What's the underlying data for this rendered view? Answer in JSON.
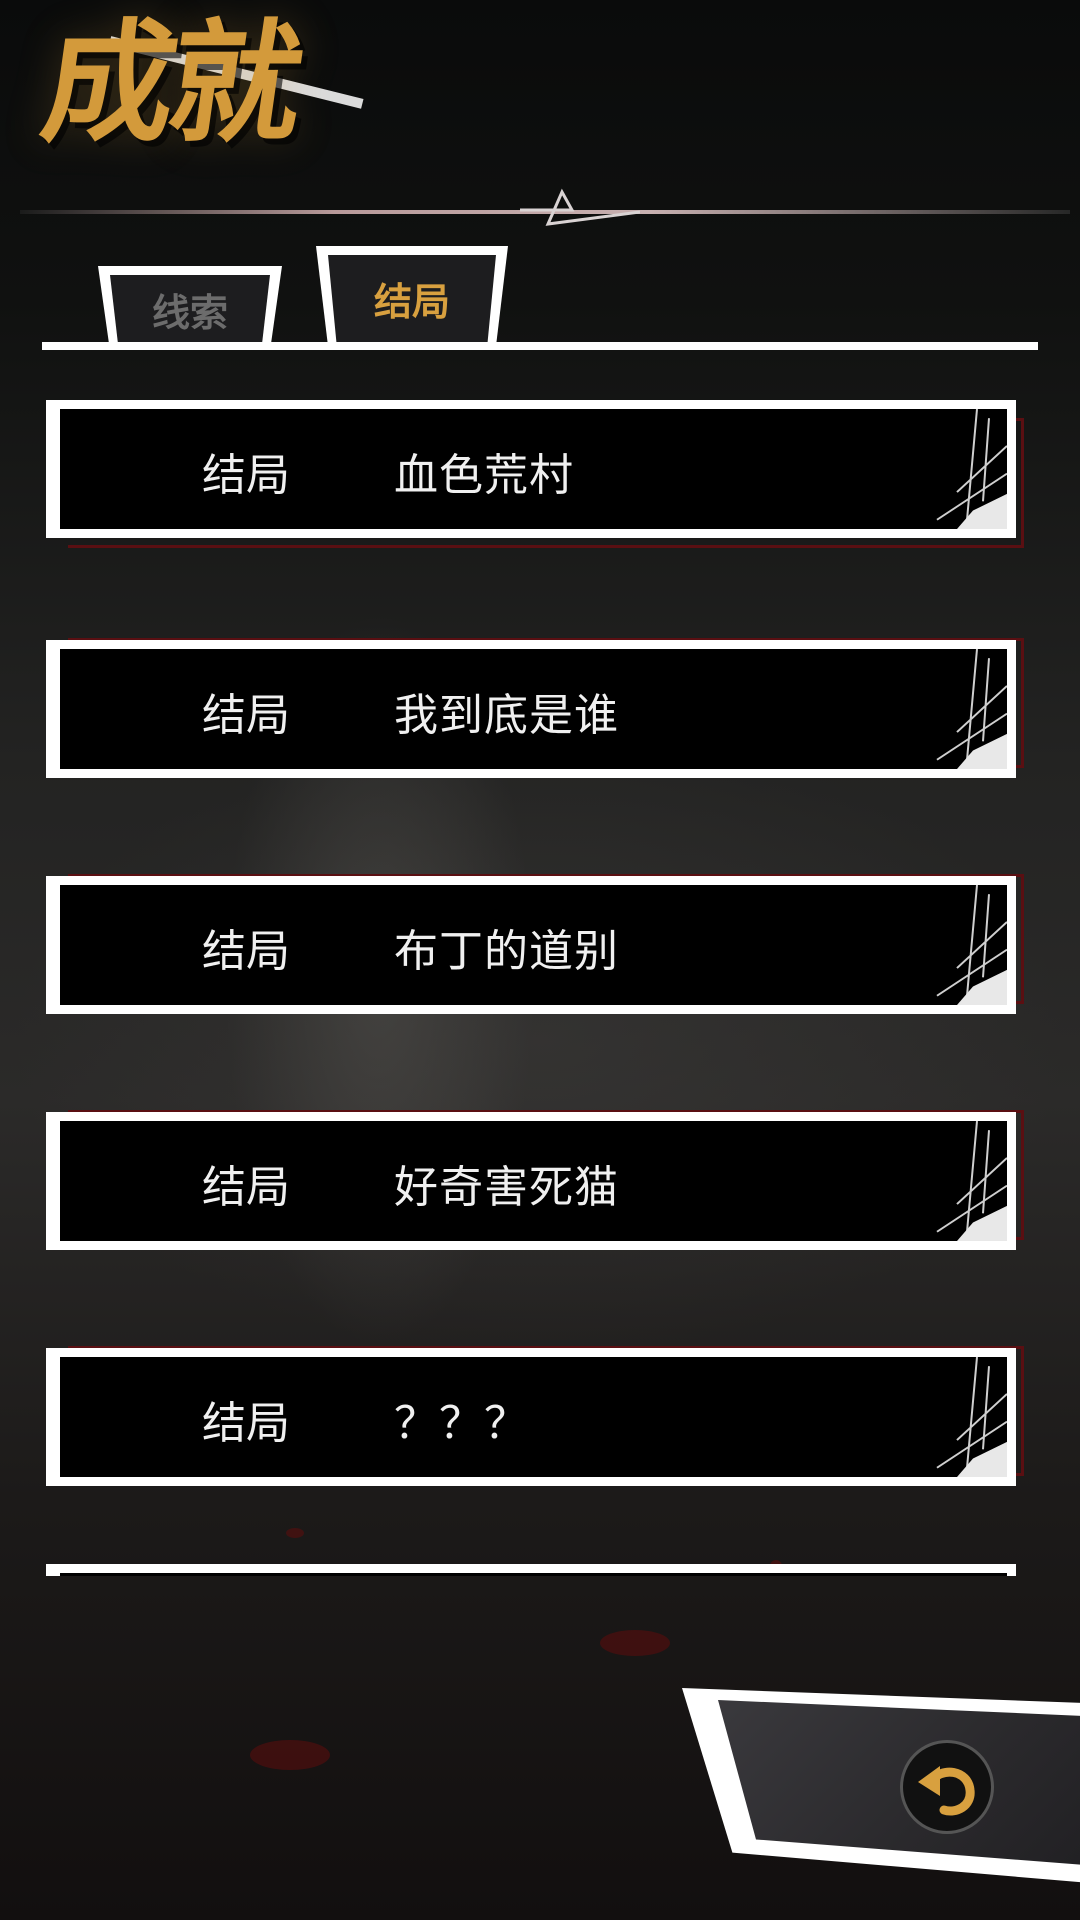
{
  "header": {
    "title": "成就"
  },
  "tabs": [
    {
      "label": "线索",
      "active": false
    },
    {
      "label": "结局",
      "active": true
    }
  ],
  "colors": {
    "accent": "#d8a03f",
    "inactive_tab": "#6c6c6c",
    "row_shadow": "#5a0f12"
  },
  "endings": [
    {
      "tag": "结局",
      "name": "血色荒村"
    },
    {
      "tag": "结局",
      "name": "我到底是谁"
    },
    {
      "tag": "结局",
      "name": "布丁的道别"
    },
    {
      "tag": "结局",
      "name": "好奇害死猫"
    },
    {
      "tag": "结局",
      "name": "？？？"
    },
    {
      "tag": "",
      "name": ""
    }
  ],
  "back_button": {
    "icon": "return-arrow-icon"
  }
}
